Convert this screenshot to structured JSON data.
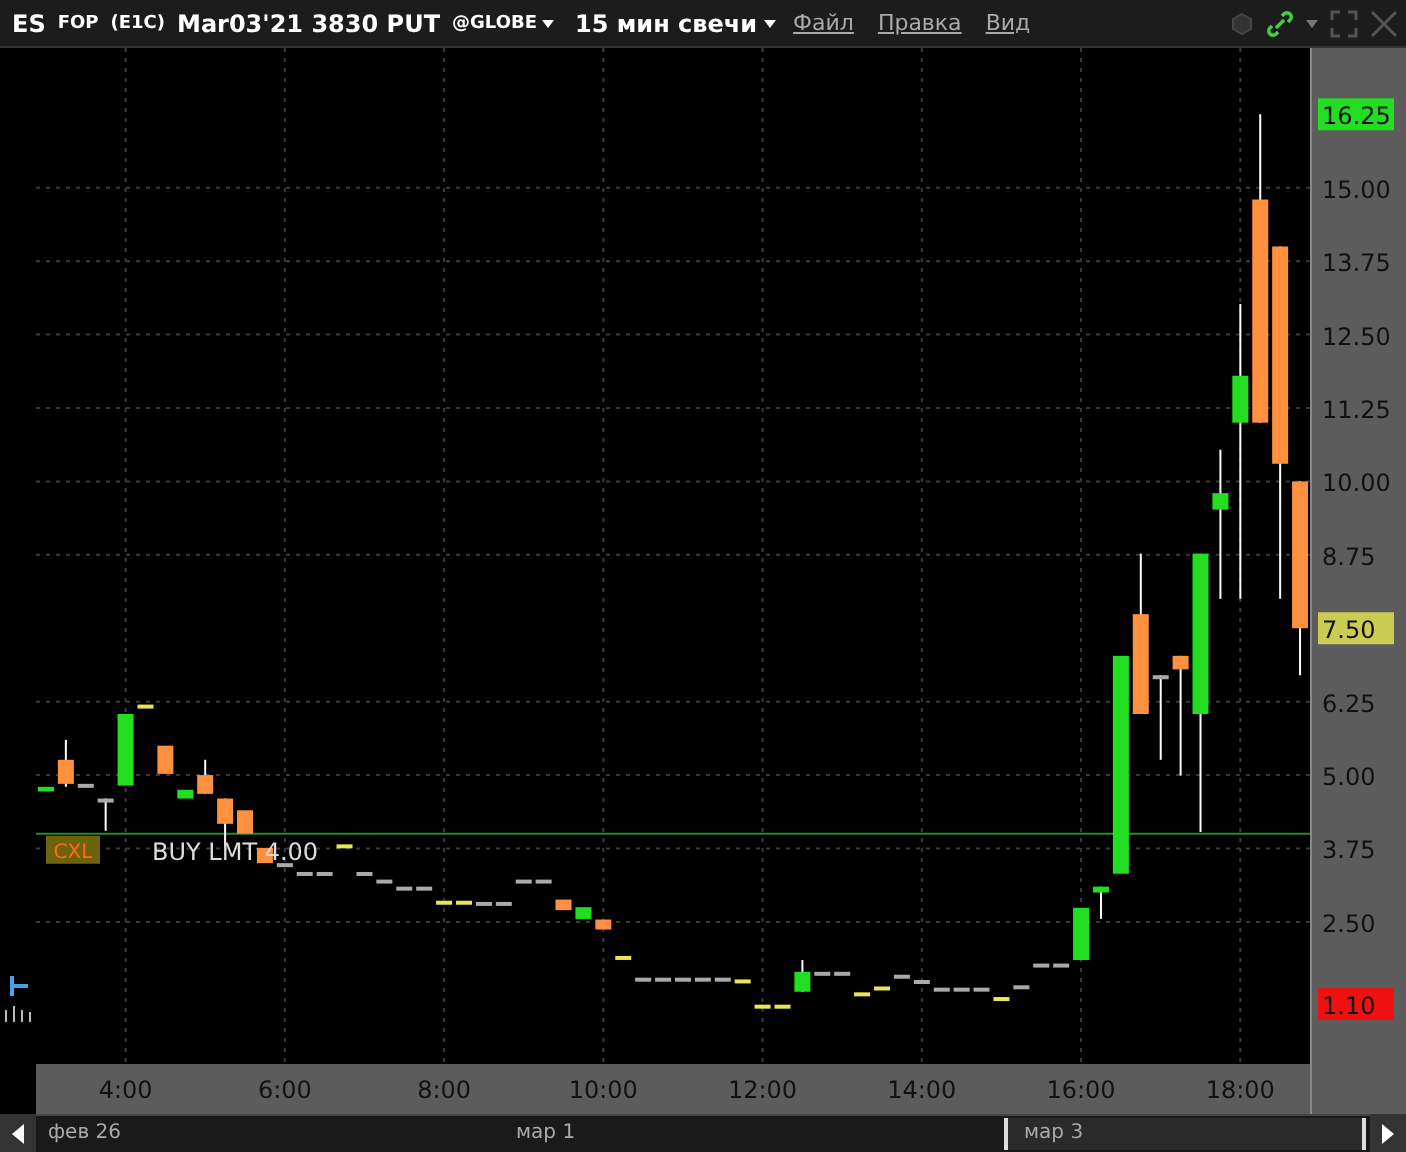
{
  "title_bar": {
    "symbol": "ES",
    "type": "FOP",
    "code": "(E1C)",
    "contract": "Mar03'21 3830 PUT",
    "exchange": "@GLOBE",
    "interval": "15 мин свечи",
    "menus": [
      "Файл",
      "Правка",
      "Вид"
    ]
  },
  "chart": {
    "chart_data": {
      "type": "candlestick",
      "x": [
        3,
        3.25,
        3.5,
        3.75,
        4,
        4.25,
        4.5,
        4.75,
        5,
        5.25,
        5.5,
        5.75,
        6,
        6.25,
        6.5,
        6.75,
        7,
        7.25,
        7.5,
        7.75,
        8,
        8.25,
        8.5,
        8.75,
        9,
        9.25,
        9.5,
        9.75,
        10,
        10.25,
        10.5,
        10.75,
        11,
        11.25,
        11.5,
        11.75,
        12,
        12.25,
        12.5,
        12.75,
        13,
        13.25,
        13.5,
        13.75,
        14,
        14.25,
        14.5,
        14.75,
        15,
        15.25,
        15.5,
        15.75,
        16,
        16.25,
        16.5,
        16.75,
        17,
        17.25,
        17.5,
        17.75,
        18,
        18.25,
        18.5,
        18.75
      ],
      "ohlc": [
        [
          4.72,
          4.85,
          4.7,
          4.8
        ],
        [
          5.26,
          5.6,
          4.8,
          4.85
        ],
        [
          4.85,
          4.85,
          4.85,
          4.85
        ],
        [
          4.6,
          4.6,
          4.05,
          4.6
        ],
        [
          4.82,
          6.04,
          4.8,
          6.04
        ],
        [
          6.18,
          6.2,
          6.18,
          6.2
        ],
        [
          5.5,
          5.5,
          5.02,
          5.02
        ],
        [
          4.6,
          4.75,
          4.6,
          4.75
        ],
        [
          5.0,
          5.26,
          4.68,
          4.68
        ],
        [
          4.6,
          4.6,
          3.78,
          4.17
        ],
        [
          4.4,
          4.4,
          4.0,
          4.0
        ],
        [
          3.76,
          3.76,
          3.5,
          3.5
        ],
        [
          3.5,
          3.5,
          3.5,
          3.5
        ],
        [
          3.35,
          3.35,
          3.35,
          3.35
        ],
        [
          3.35,
          3.35,
          3.35,
          3.35
        ],
        [
          3.78,
          3.82,
          3.78,
          3.82
        ],
        [
          3.35,
          3.35,
          3.35,
          3.35
        ],
        [
          3.22,
          3.22,
          3.22,
          3.22
        ],
        [
          3.1,
          3.1,
          3.1,
          3.1
        ],
        [
          3.1,
          3.1,
          3.1,
          3.1
        ],
        [
          2.82,
          2.86,
          2.82,
          2.86
        ],
        [
          2.82,
          2.86,
          2.82,
          2.86
        ],
        [
          2.84,
          2.84,
          2.84,
          2.84
        ],
        [
          2.84,
          2.84,
          2.84,
          2.84
        ],
        [
          3.22,
          3.22,
          3.22,
          3.22
        ],
        [
          3.22,
          3.22,
          3.22,
          3.22
        ],
        [
          2.88,
          2.88,
          2.7,
          2.7
        ],
        [
          2.55,
          2.75,
          2.55,
          2.75
        ],
        [
          2.54,
          2.54,
          2.37,
          2.37
        ],
        [
          1.88,
          1.92,
          1.88,
          1.92
        ],
        [
          1.55,
          1.55,
          1.55,
          1.55
        ],
        [
          1.55,
          1.55,
          1.55,
          1.55
        ],
        [
          1.55,
          1.55,
          1.55,
          1.55
        ],
        [
          1.55,
          1.55,
          1.55,
          1.55
        ],
        [
          1.55,
          1.55,
          1.55,
          1.55
        ],
        [
          1.48,
          1.52,
          1.48,
          1.52
        ],
        [
          1.05,
          1.09,
          1.05,
          1.09
        ],
        [
          1.05,
          1.09,
          1.05,
          1.09
        ],
        [
          1.31,
          1.85,
          1.31,
          1.65
        ],
        [
          1.65,
          1.65,
          1.65,
          1.65
        ],
        [
          1.65,
          1.65,
          1.65,
          1.65
        ],
        [
          1.26,
          1.3,
          1.26,
          1.3
        ],
        [
          1.36,
          1.4,
          1.36,
          1.4
        ],
        [
          1.6,
          1.6,
          1.56,
          1.56
        ],
        [
          1.51,
          1.51,
          1.51,
          1.51
        ],
        [
          1.38,
          1.38,
          1.38,
          1.38
        ],
        [
          1.38,
          1.38,
          1.38,
          1.38
        ],
        [
          1.38,
          1.38,
          1.38,
          1.38
        ],
        [
          1.18,
          1.22,
          1.18,
          1.22
        ],
        [
          1.42,
          1.42,
          1.38,
          1.38
        ],
        [
          1.79,
          1.79,
          1.79,
          1.79
        ],
        [
          1.79,
          1.79,
          1.79,
          1.79
        ],
        [
          1.85,
          2.74,
          1.85,
          2.74
        ],
        [
          3.0,
          3.1,
          2.55,
          3.1
        ],
        [
          3.32,
          7.03,
          3.32,
          7.03
        ],
        [
          7.74,
          8.77,
          6.04,
          6.04
        ],
        [
          6.7,
          6.7,
          5.26,
          6.7
        ],
        [
          7.03,
          7.03,
          4.99,
          6.8
        ],
        [
          6.04,
          8.77,
          4.03,
          8.77
        ],
        [
          9.52,
          10.54,
          8.0,
          9.8
        ],
        [
          11.0,
          13.02,
          8.0,
          11.8
        ],
        [
          14.8,
          16.25,
          11.0,
          11.0
        ],
        [
          14.0,
          14.0,
          8.0,
          10.3
        ],
        [
          10.0,
          10.0,
          6.7,
          7.5
        ]
      ],
      "xlim": [
        2.875,
        18.875
      ],
      "ylim": [
        0.08,
        17.38
      ],
      "xticks": [
        {
          "value": 4,
          "label": "4:00"
        },
        {
          "value": 6,
          "label": "6:00"
        },
        {
          "value": 8,
          "label": "8:00"
        },
        {
          "value": 10,
          "label": "10:00"
        },
        {
          "value": 12,
          "label": "12:00"
        },
        {
          "value": 14,
          "label": "14:00"
        },
        {
          "value": 16,
          "label": "16:00"
        },
        {
          "value": 18,
          "label": "18:00"
        }
      ],
      "yticks": [
        {
          "value": 15,
          "label": "15.00"
        },
        {
          "value": 13.75,
          "label": "13.75"
        },
        {
          "value": 12.5,
          "label": "12.50"
        },
        {
          "value": 11.25,
          "label": "11.25"
        },
        {
          "value": 10,
          "label": "10.00"
        },
        {
          "value": 8.75,
          "label": "8.75"
        },
        {
          "value": 6.25,
          "label": "6.25"
        },
        {
          "value": 5,
          "label": "5.00"
        },
        {
          "value": 3.75,
          "label": "3.75"
        },
        {
          "value": 2.5,
          "label": "2.50"
        }
      ],
      "grid": true,
      "ref_lines": [
        {
          "axis": "y",
          "value": 4.0,
          "label": "BUY LMT 4.00"
        }
      ]
    },
    "order": {
      "cancel_label": "CXL"
    },
    "price_badges": [
      {
        "label": "16.25",
        "color": "#22dd22"
      },
      {
        "label": "7.50",
        "color": "#cccc55"
      },
      {
        "label": "1.10",
        "color": "#ee1111"
      }
    ]
  },
  "scrollbar": {
    "dates": [
      "фев 26",
      "мар 1",
      "мар 3"
    ]
  }
}
